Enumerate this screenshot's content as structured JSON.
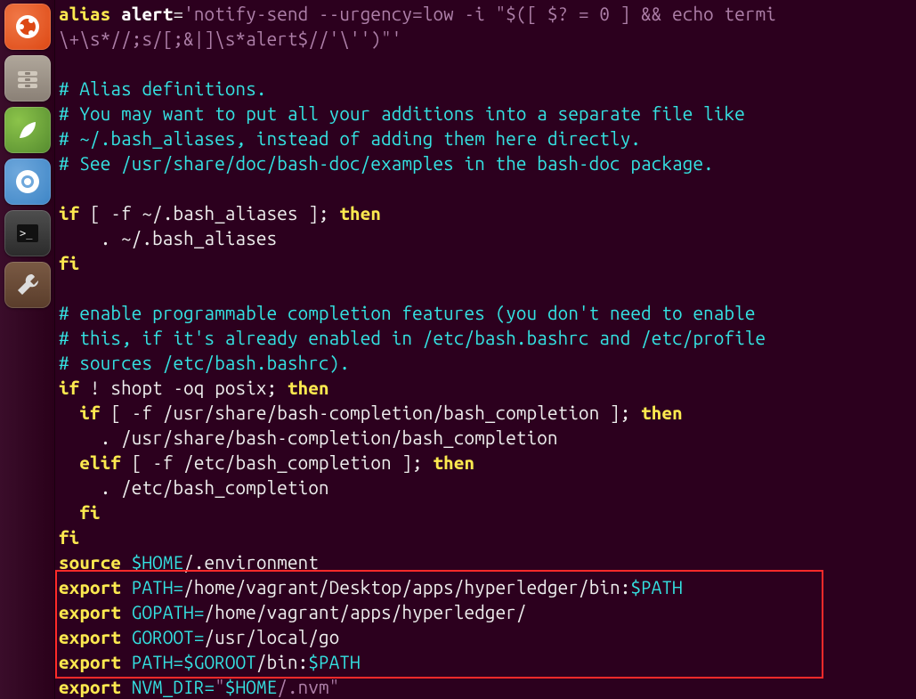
{
  "launcher": {
    "items": [
      {
        "name": "ubuntu-dash",
        "title": "Dash"
      },
      {
        "name": "files",
        "title": "Files"
      },
      {
        "name": "spring-tool",
        "title": "Spring Tool Suite"
      },
      {
        "name": "chromium",
        "title": "Chromium"
      },
      {
        "name": "terminal",
        "title": "Terminal"
      },
      {
        "name": "settings",
        "title": "System Settings"
      }
    ]
  },
  "code": {
    "l01_alias": "alias",
    "l01_alert": "alert",
    "l01_eq": "=",
    "l01_str": "'notify-send --urgency=low -i \"$([ $? = 0 ] && echo termi",
    "l02_str": "\\+\\s*//;s/[;&|]\\s*alert$//'\\'')\"'",
    "l04_cmt": "# Alias definitions.",
    "l05_cmt": "# You may want to put all your additions into a separate file like",
    "l06_cmt": "# ~/.bash_aliases, instead of adding them here directly.",
    "l07_cmt": "# See /usr/share/doc/bash-doc/examples in the bash-doc package.",
    "l09_if": "if",
    "l09_cond": " [ -f ~/.bash_aliases ]; ",
    "l09_then": "then",
    "l10_body": "    . ~/.bash_aliases",
    "l11_fi": "fi",
    "l13_cmt": "# enable programmable completion features (you don't need to enable",
    "l14_cmt": "# this, if it's already enabled in /etc/bash.bashrc and /etc/profile",
    "l15_cmt": "# sources /etc/bash.bashrc).",
    "l16_if": "if",
    "l16_mid": " ! shopt -oq posix; ",
    "l16_then": "then",
    "l17_if": "  if",
    "l17_cond": " [ -f /usr/share/bash-completion/bash_completion ]; ",
    "l17_then": "then",
    "l18_body": "    . /usr/share/bash-completion/bash_completion",
    "l19_elif": "  elif",
    "l19_cond": " [ -f /etc/bash_completion ]; ",
    "l19_then": "then",
    "l20_body": "    . /etc/bash_completion",
    "l21_fi": "  fi",
    "l22_fi": "fi",
    "l23_src": "source",
    "l23_var": " $HOME",
    "l23_rest": "/.environment",
    "l24_exp": "export",
    "l24_var": " PATH=",
    "l24_val": "/home/vagrant/Desktop/apps/hyperledger/bin:",
    "l24_pvar": "$PATH",
    "l25_exp": "export",
    "l25_var": " GOPATH=",
    "l25_val": "/home/vagrant/apps/hyperledger/",
    "l26_exp": "export",
    "l26_var": " GOROOT=",
    "l26_val": "/usr/local",
    "l26_val2": "/go",
    "l27_exp": "export",
    "l27_var": " PATH=",
    "l27_gor": "$GOROOT",
    "l27_mid": "/bin:",
    "l27_pvar": "$PATH",
    "l28_exp": "export",
    "l28_var": " NVM_DIR=",
    "l28_q": "\"",
    "l28_home": "$HOME",
    "l28_rest": "/.nvm",
    "l28_q2": "\""
  }
}
